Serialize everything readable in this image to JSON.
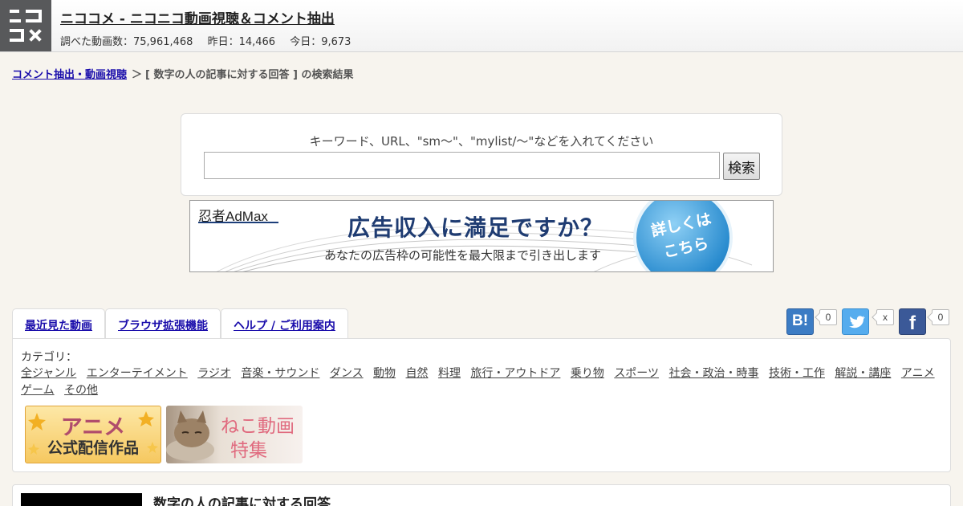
{
  "header": {
    "title": "ニココメ - ニコニコ動画視聴＆コメント抽出",
    "stats": {
      "total": "調べた動画数：75,961,468",
      "yesterday": "昨日：14,466",
      "today": "今日：9,673"
    }
  },
  "breadcrumb": {
    "link": "コメント抽出・動画視聴",
    "separator": "＞",
    "current": "[ 数字の人の記事に対する回答 ] の検索結果"
  },
  "search": {
    "hint": "キーワード、URL、\"sm〜\"、\"mylist/〜\"などを入れてください",
    "value": "",
    "button": "検索"
  },
  "ad": {
    "brand": "忍者AdMax",
    "headline": "広告収入に満足ですか？",
    "sub": "あなたの広告枠の可能性を最大限まで引き出します",
    "cta_line1": "詳しくは",
    "cta_line2": "こちら"
  },
  "tabs": [
    "最近見た動画",
    "ブラウザ拡張機能",
    "ヘルプ / ご利用案内"
  ],
  "social": {
    "hatena_label": "B!",
    "hatena_count": "0",
    "twitter_count": "x",
    "facebook_label": "f",
    "facebook_count": "0",
    "colors": {
      "hatena": "#3c7cc4",
      "twitter": "#55acee",
      "facebook": "#3b5998"
    }
  },
  "category": {
    "label": "カテゴリ：",
    "items": [
      "全ジャンル",
      "エンターテイメント",
      "ラジオ",
      "音楽・サウンド",
      "ダンス",
      "動物",
      "自然",
      "料理",
      "旅行・アウトドア",
      "乗り物",
      "スポーツ",
      "社会・政治・時事",
      "技術・工作",
      "解説・講座",
      "アニメ",
      "ゲーム",
      "その他"
    ]
  },
  "banners": {
    "anime_line1": "アニメ",
    "anime_line2": "公式配信作品",
    "neko_line1": "ねこ動画",
    "neko_line2": "特集"
  },
  "result": {
    "title": "数字の人の記事に対する回答"
  }
}
